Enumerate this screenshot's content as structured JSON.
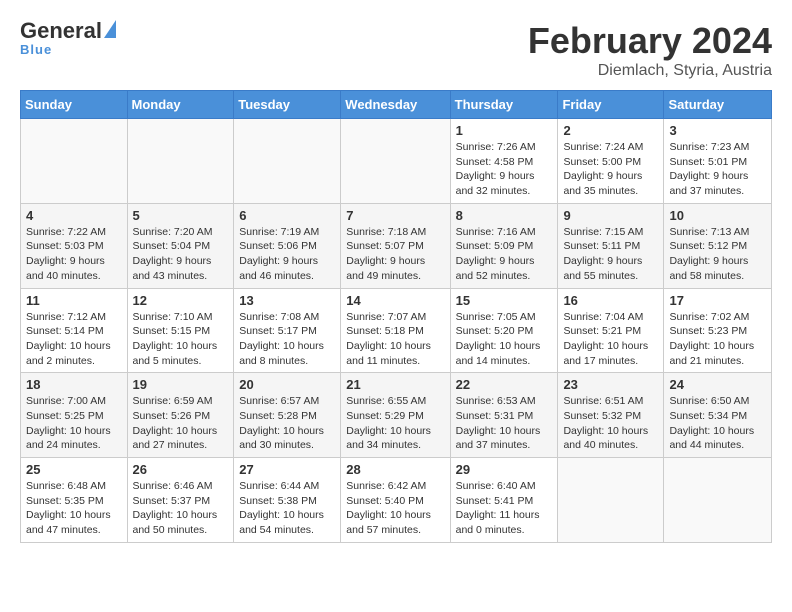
{
  "header": {
    "logo_line1": "General",
    "logo_line2": "Blue",
    "month_year": "February 2024",
    "location": "Diemlach, Styria, Austria"
  },
  "weekdays": [
    "Sunday",
    "Monday",
    "Tuesday",
    "Wednesday",
    "Thursday",
    "Friday",
    "Saturday"
  ],
  "weeks": [
    [
      {
        "day": "",
        "info": ""
      },
      {
        "day": "",
        "info": ""
      },
      {
        "day": "",
        "info": ""
      },
      {
        "day": "",
        "info": ""
      },
      {
        "day": "1",
        "info": "Sunrise: 7:26 AM\nSunset: 4:58 PM\nDaylight: 9 hours and 32 minutes."
      },
      {
        "day": "2",
        "info": "Sunrise: 7:24 AM\nSunset: 5:00 PM\nDaylight: 9 hours and 35 minutes."
      },
      {
        "day": "3",
        "info": "Sunrise: 7:23 AM\nSunset: 5:01 PM\nDaylight: 9 hours and 37 minutes."
      }
    ],
    [
      {
        "day": "4",
        "info": "Sunrise: 7:22 AM\nSunset: 5:03 PM\nDaylight: 9 hours and 40 minutes."
      },
      {
        "day": "5",
        "info": "Sunrise: 7:20 AM\nSunset: 5:04 PM\nDaylight: 9 hours and 43 minutes."
      },
      {
        "day": "6",
        "info": "Sunrise: 7:19 AM\nSunset: 5:06 PM\nDaylight: 9 hours and 46 minutes."
      },
      {
        "day": "7",
        "info": "Sunrise: 7:18 AM\nSunset: 5:07 PM\nDaylight: 9 hours and 49 minutes."
      },
      {
        "day": "8",
        "info": "Sunrise: 7:16 AM\nSunset: 5:09 PM\nDaylight: 9 hours and 52 minutes."
      },
      {
        "day": "9",
        "info": "Sunrise: 7:15 AM\nSunset: 5:11 PM\nDaylight: 9 hours and 55 minutes."
      },
      {
        "day": "10",
        "info": "Sunrise: 7:13 AM\nSunset: 5:12 PM\nDaylight: 9 hours and 58 minutes."
      }
    ],
    [
      {
        "day": "11",
        "info": "Sunrise: 7:12 AM\nSunset: 5:14 PM\nDaylight: 10 hours and 2 minutes."
      },
      {
        "day": "12",
        "info": "Sunrise: 7:10 AM\nSunset: 5:15 PM\nDaylight: 10 hours and 5 minutes."
      },
      {
        "day": "13",
        "info": "Sunrise: 7:08 AM\nSunset: 5:17 PM\nDaylight: 10 hours and 8 minutes."
      },
      {
        "day": "14",
        "info": "Sunrise: 7:07 AM\nSunset: 5:18 PM\nDaylight: 10 hours and 11 minutes."
      },
      {
        "day": "15",
        "info": "Sunrise: 7:05 AM\nSunset: 5:20 PM\nDaylight: 10 hours and 14 minutes."
      },
      {
        "day": "16",
        "info": "Sunrise: 7:04 AM\nSunset: 5:21 PM\nDaylight: 10 hours and 17 minutes."
      },
      {
        "day": "17",
        "info": "Sunrise: 7:02 AM\nSunset: 5:23 PM\nDaylight: 10 hours and 21 minutes."
      }
    ],
    [
      {
        "day": "18",
        "info": "Sunrise: 7:00 AM\nSunset: 5:25 PM\nDaylight: 10 hours and 24 minutes."
      },
      {
        "day": "19",
        "info": "Sunrise: 6:59 AM\nSunset: 5:26 PM\nDaylight: 10 hours and 27 minutes."
      },
      {
        "day": "20",
        "info": "Sunrise: 6:57 AM\nSunset: 5:28 PM\nDaylight: 10 hours and 30 minutes."
      },
      {
        "day": "21",
        "info": "Sunrise: 6:55 AM\nSunset: 5:29 PM\nDaylight: 10 hours and 34 minutes."
      },
      {
        "day": "22",
        "info": "Sunrise: 6:53 AM\nSunset: 5:31 PM\nDaylight: 10 hours and 37 minutes."
      },
      {
        "day": "23",
        "info": "Sunrise: 6:51 AM\nSunset: 5:32 PM\nDaylight: 10 hours and 40 minutes."
      },
      {
        "day": "24",
        "info": "Sunrise: 6:50 AM\nSunset: 5:34 PM\nDaylight: 10 hours and 44 minutes."
      }
    ],
    [
      {
        "day": "25",
        "info": "Sunrise: 6:48 AM\nSunset: 5:35 PM\nDaylight: 10 hours and 47 minutes."
      },
      {
        "day": "26",
        "info": "Sunrise: 6:46 AM\nSunset: 5:37 PM\nDaylight: 10 hours and 50 minutes."
      },
      {
        "day": "27",
        "info": "Sunrise: 6:44 AM\nSunset: 5:38 PM\nDaylight: 10 hours and 54 minutes."
      },
      {
        "day": "28",
        "info": "Sunrise: 6:42 AM\nSunset: 5:40 PM\nDaylight: 10 hours and 57 minutes."
      },
      {
        "day": "29",
        "info": "Sunrise: 6:40 AM\nSunset: 5:41 PM\nDaylight: 11 hours and 0 minutes."
      },
      {
        "day": "",
        "info": ""
      },
      {
        "day": "",
        "info": ""
      }
    ]
  ]
}
